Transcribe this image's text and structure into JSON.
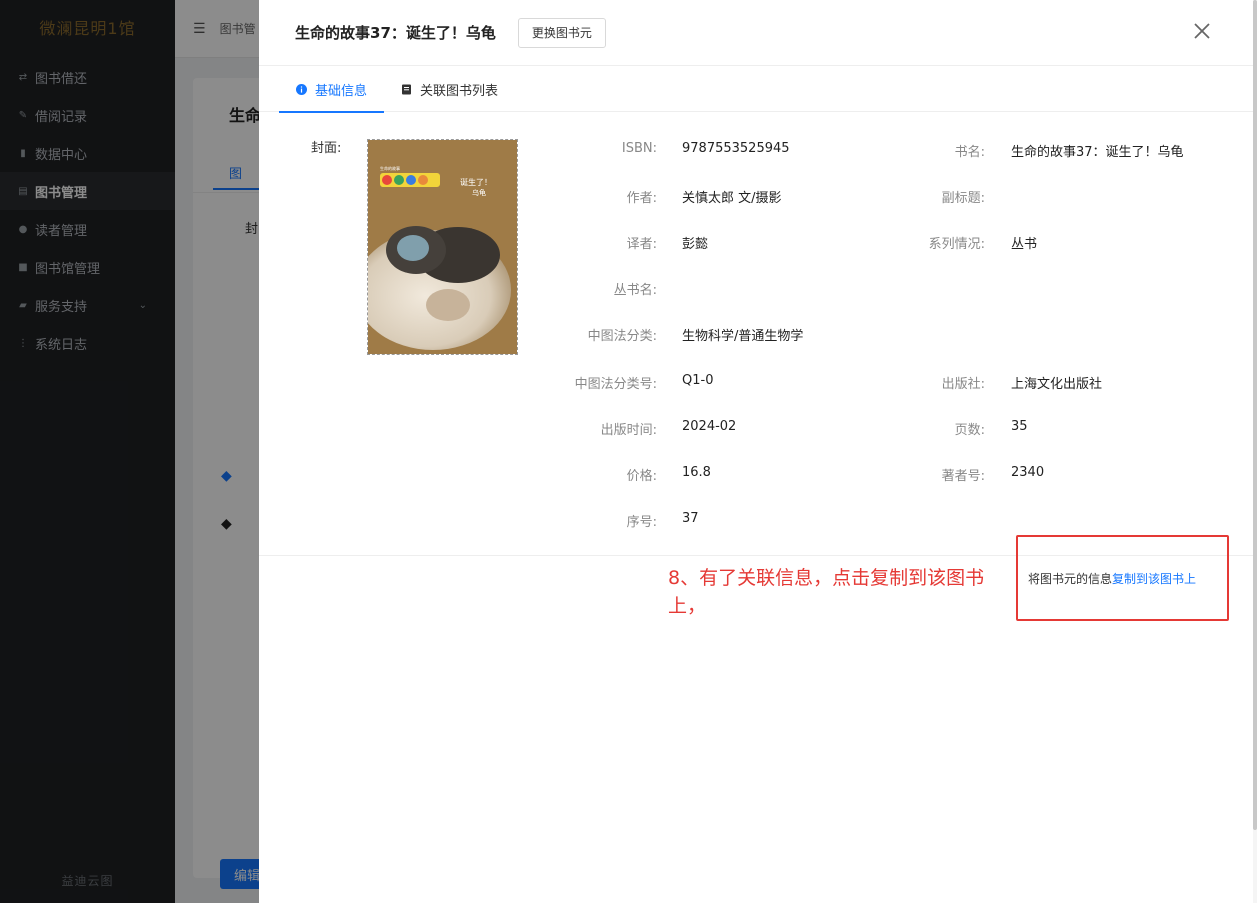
{
  "app": {
    "brand": "微澜昆明1馆",
    "footer": "益迪云图",
    "nav": [
      {
        "label": "图书借还",
        "icon": "swap-icon"
      },
      {
        "label": "借阅记录",
        "icon": "edit-icon"
      },
      {
        "label": "数据中心",
        "icon": "bar-chart-icon"
      },
      {
        "label": "图书管理",
        "icon": "book-icon",
        "active": true
      },
      {
        "label": "读者管理",
        "icon": "users-icon"
      },
      {
        "label": "图书馆管理",
        "icon": "library-icon"
      },
      {
        "label": "服务支持",
        "icon": "service-icon",
        "has_submenu": true
      },
      {
        "label": "系统日志",
        "icon": "grid-icon"
      }
    ],
    "breadcrumb": "图书管",
    "bg_card": {
      "title": "生命",
      "tab": "图",
      "label": "封",
      "edit_button": "编辑"
    }
  },
  "drawer": {
    "title": "生命的故事37：诞生了！乌龟",
    "change_button": "更换图书元",
    "tabs": [
      {
        "label": "基础信息",
        "icon": "info-icon",
        "active": true
      },
      {
        "label": "关联图书列表",
        "icon": "list-icon",
        "active": false
      }
    ],
    "cover_label": "封面:",
    "cover_text": {
      "series": "生命的故事",
      "title": "诞生了！",
      "subtitle": "乌龟"
    },
    "fields": {
      "isbn": {
        "label": "ISBN:",
        "value": "9787553525945"
      },
      "book_name": {
        "label": "书名:",
        "value": "生命的故事37：诞生了！乌龟"
      },
      "author": {
        "label": "作者:",
        "value": "关慎太郎 文/摄影"
      },
      "subtitle": {
        "label": "副标题:",
        "value": ""
      },
      "translator": {
        "label": "译者:",
        "value": "彭懿"
      },
      "series_info": {
        "label": "系列情况:",
        "value": "丛书"
      },
      "series_name": {
        "label": "丛书名:",
        "value": ""
      },
      "clc": {
        "label": "中图法分类:",
        "value": "生物科学/普通生物学"
      },
      "clc_no": {
        "label": "中图法分类号:",
        "value": "Q1-0"
      },
      "publisher": {
        "label": "出版社:",
        "value": "上海文化出版社"
      },
      "pub_date": {
        "label": "出版时间:",
        "value": "2024-02"
      },
      "pages": {
        "label": "页数:",
        "value": "35"
      },
      "price": {
        "label": "价格:",
        "value": "16.8"
      },
      "author_no": {
        "label": "著者号:",
        "value": "2340"
      },
      "seq": {
        "label": "序号:",
        "value": "37"
      }
    },
    "copy_prefix": "将图书元的信息",
    "copy_link": "复制到该图书上"
  },
  "annotation": {
    "text": "8、有了关联信息，点击复制到该图书上，",
    "color": "#e53935"
  },
  "colors": {
    "accent": "#1677ff",
    "sidebar_bg": "#1f2124"
  }
}
